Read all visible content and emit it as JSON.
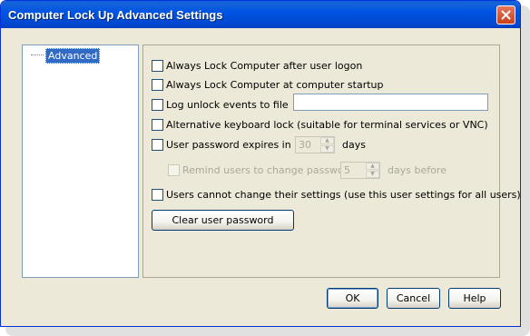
{
  "window": {
    "title": "Computer Lock Up Advanced Settings"
  },
  "tree": {
    "items": [
      {
        "label": "Advanced",
        "selected": true
      }
    ]
  },
  "options": {
    "lock_after_logon": {
      "label": "Always Lock Computer after user logon",
      "checked": false
    },
    "lock_at_startup": {
      "label": "Always Lock Computer at computer startup",
      "checked": false
    },
    "log_unlock": {
      "label": "Log unlock events to file",
      "checked": false,
      "file_value": ""
    },
    "alt_keyboard_lock": {
      "label": "Alternative keyboard lock  (suitable for terminal services or VNC)",
      "checked": false
    },
    "password_expires": {
      "label": "User password expires in",
      "checked": false,
      "days_value": "30",
      "days_suffix": "days"
    },
    "remind_users": {
      "label": "Remind users to change password",
      "checked": false,
      "enabled": false,
      "days_value": "5",
      "suffix": "days before"
    },
    "cannot_change": {
      "label": "Users cannot change their settings (use this user settings for all users)",
      "checked": false
    }
  },
  "buttons": {
    "clear_password": "Clear user password",
    "ok": "OK",
    "cancel": "Cancel",
    "help": "Help"
  },
  "colors": {
    "titlebar": "#0054e3",
    "selection": "#316ac5",
    "dialog_bg": "#ece9d8",
    "close_button": "#c9401a"
  },
  "icons": {
    "close": "close-icon",
    "spin_up": "spin-up-arrow-icon",
    "spin_down": "spin-down-arrow-icon"
  }
}
